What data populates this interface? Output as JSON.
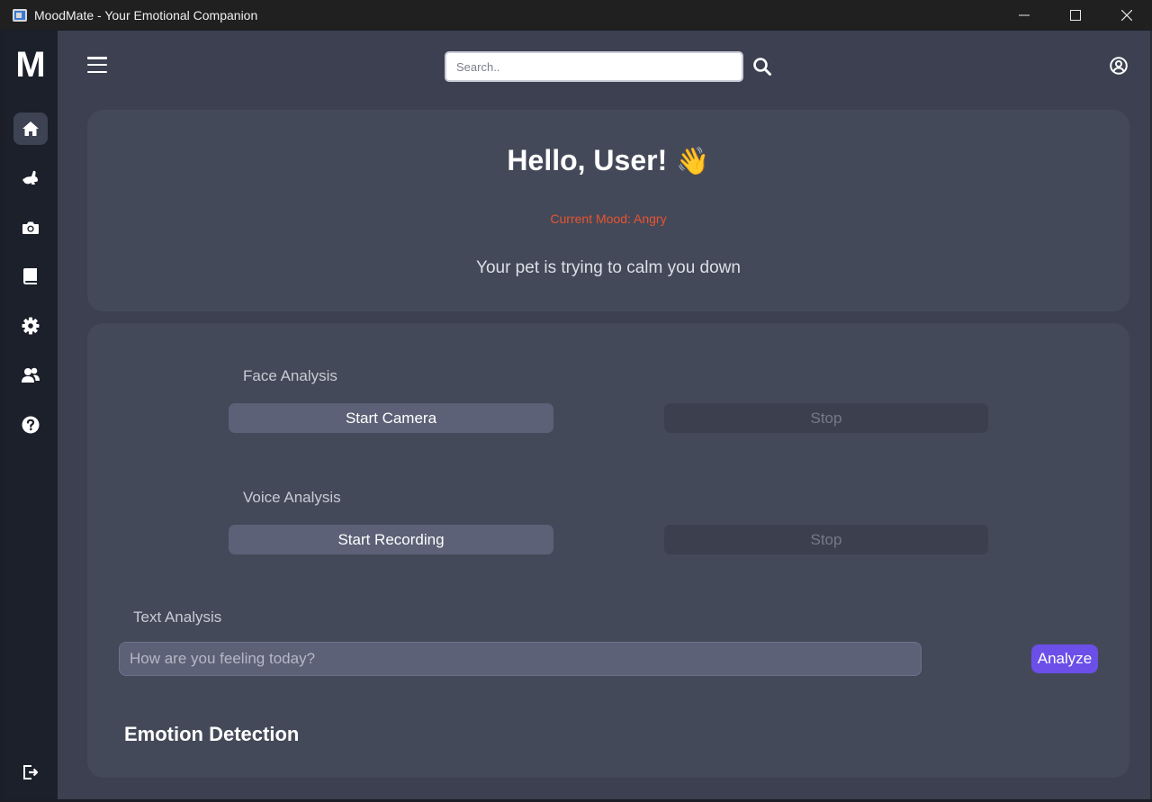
{
  "window": {
    "title": "MoodMate - Your Emotional Companion",
    "controls": [
      "minimize-icon",
      "maximize-icon",
      "close-icon"
    ]
  },
  "sidebar": {
    "logo": "M",
    "items": [
      {
        "name": "home",
        "icon": "home-icon",
        "active": true
      },
      {
        "name": "pet",
        "icon": "rabbit-icon"
      },
      {
        "name": "camera",
        "icon": "camera-icon"
      },
      {
        "name": "journal",
        "icon": "book-icon"
      },
      {
        "name": "settings",
        "icon": "gear-icon"
      },
      {
        "name": "community",
        "icon": "users-icon"
      },
      {
        "name": "help",
        "icon": "question-icon"
      }
    ],
    "logout_icon": "logout-icon"
  },
  "header": {
    "search_placeholder": "Search..",
    "search_icon": "search-icon",
    "user_icon": "user-circle-icon"
  },
  "greeting": {
    "title": "Hello, User!",
    "emoji": "👋",
    "mood_label": "Current Mood: Angry",
    "pet_message": "Your pet is trying to calm you down"
  },
  "analysis": {
    "face": {
      "label": "Face Analysis",
      "start": "Start Camera",
      "stop": "Stop"
    },
    "voice": {
      "label": "Voice Analysis",
      "start": "Start Recording",
      "stop": "Stop"
    },
    "text": {
      "label": "Text Analysis",
      "placeholder": "How are you feeling today?",
      "analyze": "Analyze"
    }
  },
  "emotion_detection": {
    "heading": "Emotion Detection"
  },
  "colors": {
    "accent": "#6b4fe8",
    "mood_angry": "#e8542f",
    "sidebar_bg": "#1c202b",
    "card_bg": "#444959",
    "main_bg": "#3c4050"
  }
}
